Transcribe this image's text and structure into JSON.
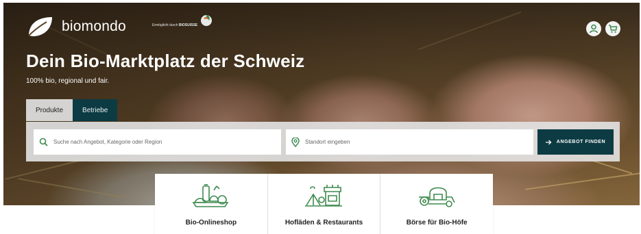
{
  "brand": {
    "name": "biomondo",
    "partner_text": "Ermöglicht durch",
    "partner_brand": "BIOSUISSE"
  },
  "header": {
    "icons": [
      {
        "name": "user-icon"
      },
      {
        "name": "cart-icon"
      }
    ]
  },
  "hero": {
    "title": "Dein Bio-Marktplatz der Schweiz",
    "subtitle": "100% bio, regional und fair."
  },
  "tabs": [
    {
      "label": "Produkte",
      "active": true
    },
    {
      "label": "Betriebe",
      "active": false
    }
  ],
  "search": {
    "query_placeholder": "Suche nach Angebot, Kategorie oder Region",
    "location_placeholder": "Standort eingeben",
    "submit_label": "ANGEBOT FINDEN"
  },
  "categories": [
    {
      "label": "Bio-Onlineshop",
      "icon": "grocery-icon"
    },
    {
      "label": "Hofläden & Restaurants",
      "icon": "farm-shop-icon"
    },
    {
      "label": "Börse für Bio-Höfe",
      "icon": "tractor-icon"
    }
  ],
  "colors": {
    "accent": "#0d3b43",
    "icon_green": "#3d8a4e"
  }
}
